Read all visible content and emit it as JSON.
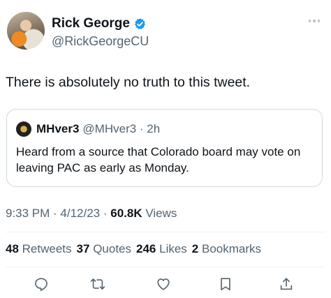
{
  "author": {
    "name": "Rick George",
    "handle": "@RickGeorgeCU",
    "verified": true
  },
  "tweet": {
    "text": "There is absolutely no truth to this tweet."
  },
  "quoted_tweet": {
    "name": "MHver3",
    "meta": "@MHver3 · 2h",
    "text": "Heard from a source that Colorado board may vote on leaving PAC as early as Monday."
  },
  "meta": {
    "time_date": "9:33 PM · 4/12/23 · ",
    "views_count": "60.8K",
    "views_label": " Views"
  },
  "stats": {
    "retweets_count": "48",
    "retweets_label": "Retweets",
    "quotes_count": "37",
    "quotes_label": "Quotes",
    "likes_count": "246",
    "likes_label": "Likes",
    "bookmarks_count": "2",
    "bookmarks_label": "Bookmarks"
  },
  "actions": [
    "reply-icon",
    "retweet-icon",
    "like-icon",
    "bookmark-icon",
    "share-icon"
  ],
  "colors": {
    "text": "#0f1419",
    "secondary": "#536471",
    "border": "#cfd9de",
    "verified": "#1d9bf0"
  }
}
